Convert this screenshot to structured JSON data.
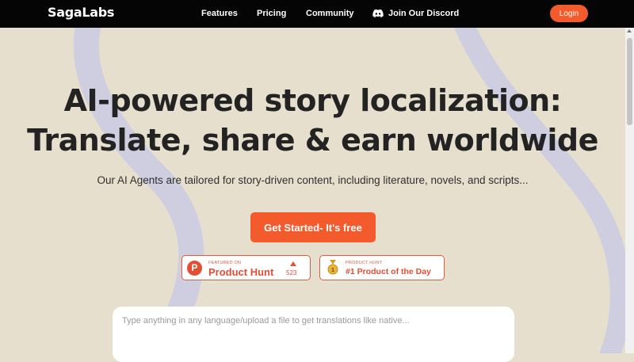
{
  "brand": {
    "name": "SagaLabs"
  },
  "nav": {
    "features": "Features",
    "pricing": "Pricing",
    "community": "Community",
    "discord": "Join Our Discord",
    "login": "Login"
  },
  "hero": {
    "headline_line1": "AI-powered story localization:",
    "headline_line2": "Translate, share & earn worldwide",
    "subtitle": "Our AI Agents are tailored for story-driven content, including literature, novels, and scripts...",
    "cta": "Get Started- It's free"
  },
  "badges": {
    "product_hunt": {
      "small": "FEATURED ON",
      "main": "Product Hunt",
      "votes": "523"
    },
    "product_of_day": {
      "small": "PRODUCT HUNT",
      "main": "#1 Product of the Day"
    }
  },
  "translator": {
    "placeholder": "Type anything in any language/upload a file to get translations like native..."
  },
  "colors": {
    "accent": "#f35b2c",
    "background": "#e7dfce",
    "navbar": "#050505",
    "decoration": "#cfcde0"
  },
  "icons": {
    "discord": "discord-icon",
    "product_hunt": "product-hunt-logo",
    "medal": "medal-icon"
  }
}
